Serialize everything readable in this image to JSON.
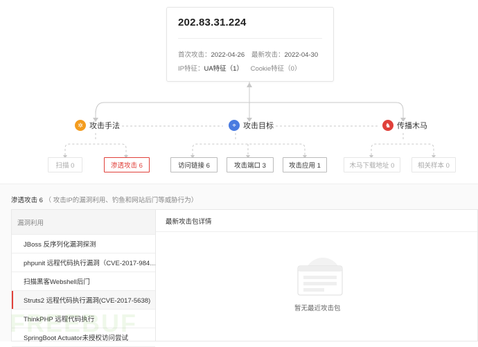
{
  "ip_card": {
    "ip": "202.83.31.224",
    "first_attack_label": "首次攻击：",
    "first_attack_value": "2022-04-26",
    "latest_attack_label": "最新攻击：",
    "latest_attack_value": "2022-04-30",
    "ip_feature_label": "IP特征：",
    "ua_feature": "UA特征（1）",
    "cookie_feature": "Cookie特征（0）"
  },
  "categories": {
    "methods": {
      "label": "攻击手法",
      "color": "#f39c1f",
      "icon": "gear-icon"
    },
    "targets": {
      "label": "攻击目标",
      "color": "#4a7be0",
      "icon": "target-icon"
    },
    "trojan": {
      "label": "传播木马",
      "color": "#e0403a",
      "icon": "horse-icon"
    }
  },
  "leaves": {
    "scan": "扫描 0",
    "pentest": "渗透攻击 6",
    "visit_link": "访问链接 6",
    "attack_port": "攻击端口 3",
    "attack_app": "攻击应用 1",
    "trojan_download": "木马下载地址 0",
    "related_samples": "相关样本 0"
  },
  "detail": {
    "section_title": "渗透攻击 6",
    "section_hint": "（ 攻击IP的漏洞利用、钓鱼和网站后门等威胁行为）",
    "list_header": "漏洞利用",
    "items": [
      "JBoss 反序列化漏洞探测",
      "phpunit 远程代码执行漏洞（CVE-2017-984…",
      "扫描黑客Webshell后门",
      "Struts2 远程代码执行漏洞(CVE-2017-5638)",
      "ThinkPHP 远程代码执行",
      "SpringBoot Actuator未授权访问尝试"
    ],
    "right_header": "最新攻击包详情",
    "empty_text": "暂无最近攻击包",
    "watermark": "FREEBUF"
  },
  "colors": {
    "accent_red": "#e0403a",
    "orange": "#f39c1f",
    "blue": "#4a7be0"
  }
}
